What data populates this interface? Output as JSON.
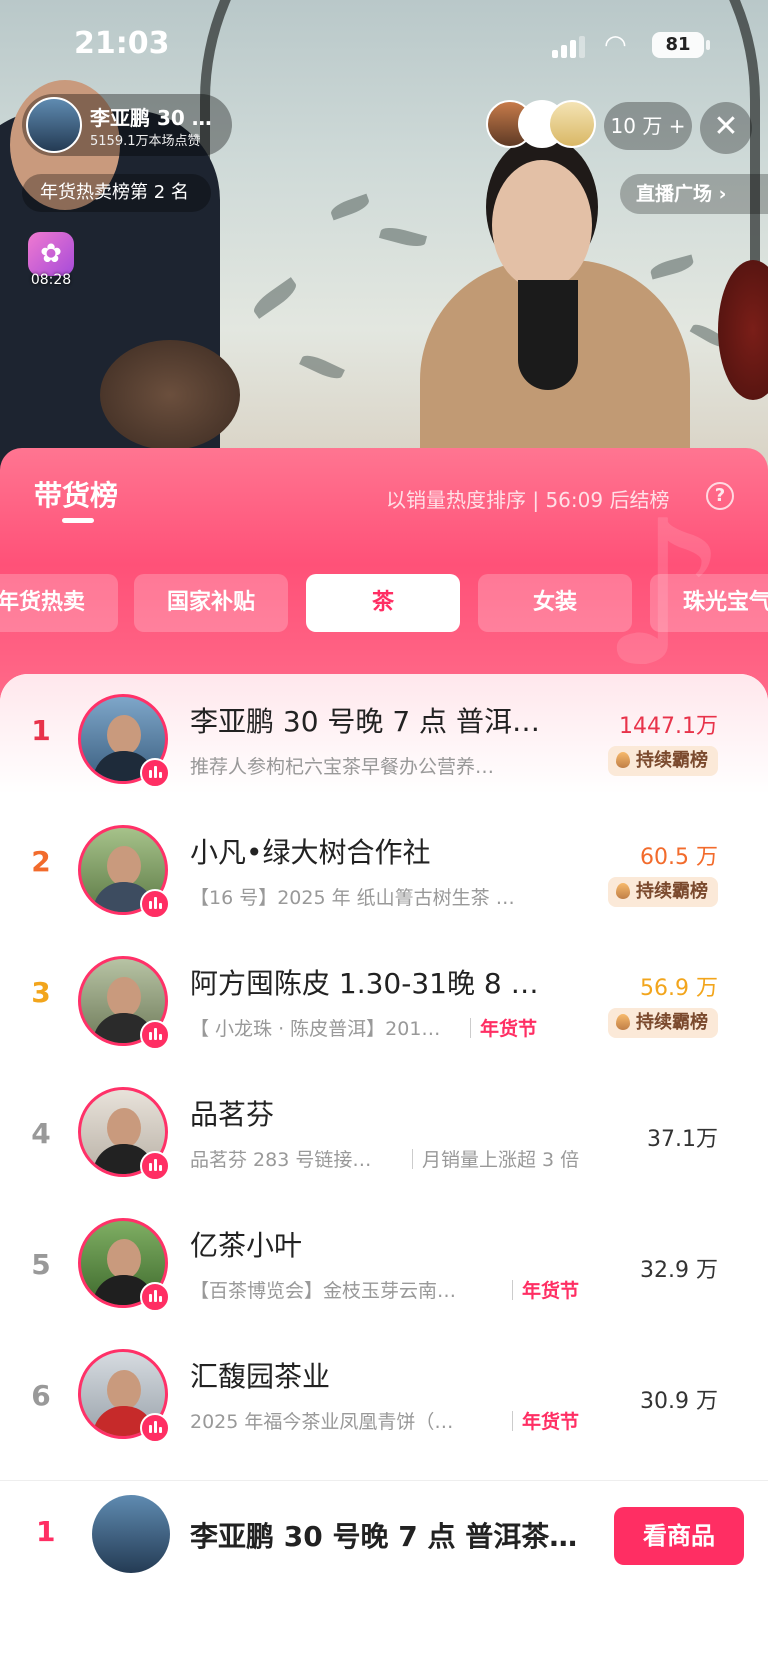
{
  "status_bar": {
    "time": "21:03",
    "battery": "81"
  },
  "anchor": {
    "name": "李亚鹏 30 …",
    "likes": "5159.1万本场点赞"
  },
  "viewer_count": "10 万 +",
  "hot_rank_label": "年货热卖榜第 2 名",
  "plaza_label": "直播广场 ›",
  "live_timer": "08:28",
  "panel": {
    "title": "带货榜",
    "note": "以销量热度排序 | 56:09 后结榜",
    "help": "?"
  },
  "categories": [
    "年货热卖",
    "国家补贴",
    "茶",
    "女装",
    "珠光宝气"
  ],
  "active_category": "茶",
  "colors": {
    "accent": "#ff2e63",
    "rank1": "#e8334a",
    "rank2": "#f26b2c",
    "rank3": "#f2a51c",
    "rank_other": "#999999"
  },
  "rows": [
    {
      "rank": "1",
      "title": "李亚鹏 30 号晚 7 点  普洱…",
      "subtitle": "推荐人参枸杞六宝茶早餐办公营养…",
      "tag": "",
      "sales": "1447.1万",
      "hot": "持续霸榜"
    },
    {
      "rank": "2",
      "title": "小凡•绿大树合作社",
      "subtitle": "【16 号】2025 年 纸山箐古树生茶 …",
      "tag": "",
      "sales": "60.5 万",
      "hot": "持续霸榜"
    },
    {
      "rank": "3",
      "title": "阿方囤陈皮 1.30-31晚 8 …",
      "subtitle": "【 小龙珠 · 陈皮普洱】201…",
      "tag": "年货节",
      "sales": "56.9 万",
      "hot": "持续霸榜"
    },
    {
      "rank": "4",
      "title": "品茗芬",
      "subtitle": "品茗芬 283 号链接…",
      "tag": "月销量上涨超 3 倍",
      "sales": "37.1万",
      "hot": ""
    },
    {
      "rank": "5",
      "title": "亿茶小叶",
      "subtitle": "【百茶博览会】金枝玉芽云南…",
      "tag": "年货节",
      "sales": "32.9 万",
      "hot": ""
    },
    {
      "rank": "6",
      "title": "汇馥园茶业",
      "subtitle": "2025 年福今茶业凤凰青饼（…",
      "tag": "年货节",
      "sales": "30.9 万",
      "hot": ""
    }
  ],
  "bottom": {
    "rank": "1",
    "title": "李亚鹏 30 号晚 7 点  普洱茶礼…",
    "button": "看商品"
  }
}
